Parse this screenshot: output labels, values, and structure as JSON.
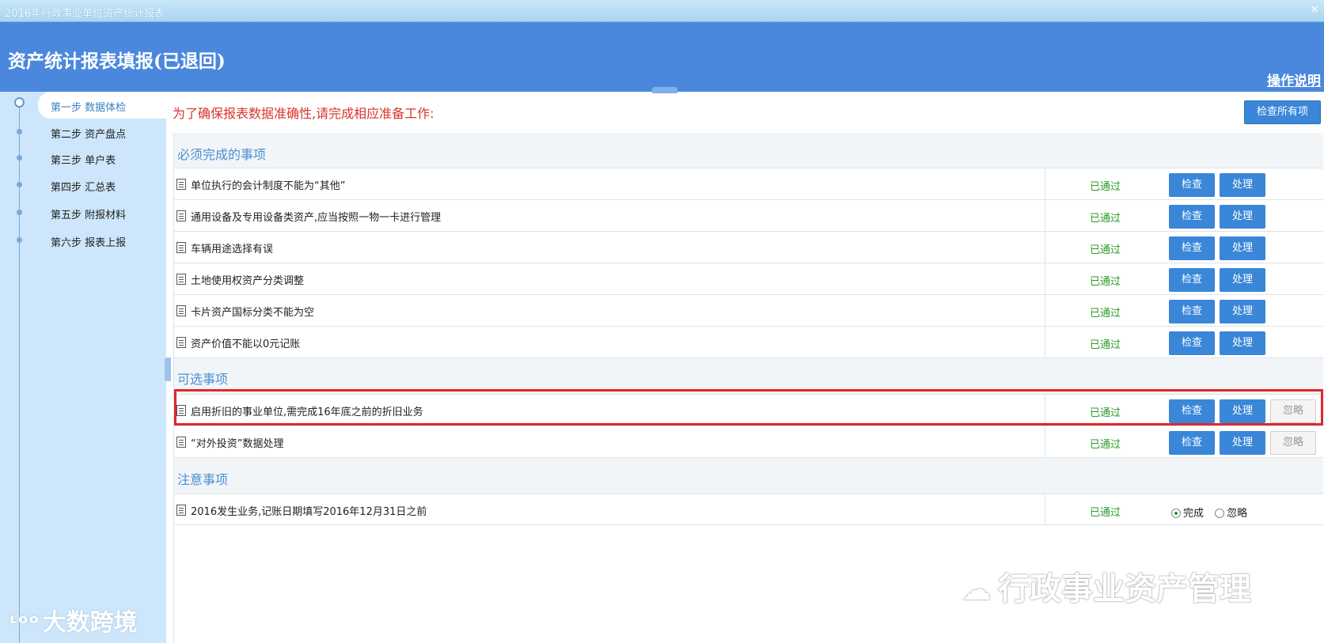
{
  "window": {
    "title": "2016年行政事业单位资产统计报表",
    "close_glyph": "×"
  },
  "header": {
    "title": "资产统计报表填报(已退回)",
    "help_link": "操作说明"
  },
  "sidebar": {
    "steps": [
      {
        "label": "第一步 数据体检",
        "active": true
      },
      {
        "label": "第二步 资产盘点",
        "active": false
      },
      {
        "label": "第三步 单户表",
        "active": false
      },
      {
        "label": "第四步 汇总表",
        "active": false
      },
      {
        "label": "第五步 附报材料",
        "active": false
      },
      {
        "label": "第六步 报表上报",
        "active": false
      }
    ]
  },
  "main": {
    "notice": "为了确保报表数据准确性,请完成相应准备工作:",
    "check_all_label": "检查所有项",
    "check_label": "检查",
    "handle_label": "处理",
    "ignore_label": "忽略",
    "sections": [
      {
        "title": "必须完成的事项",
        "items": [
          {
            "text": "单位执行的会计制度不能为“其他”",
            "status": "已通过"
          },
          {
            "text": "通用设备及专用设备类资产,应当按照一物一卡进行管理",
            "status": "已通过"
          },
          {
            "text": "车辆用途选择有误",
            "status": "已通过"
          },
          {
            "text": "土地使用权资产分类调整",
            "status": "已通过"
          },
          {
            "text": "卡片资产国标分类不能为空",
            "status": "已通过"
          },
          {
            "text": "资产价值不能以0元记账",
            "status": "已通过"
          }
        ]
      },
      {
        "title": "可选事项",
        "items": [
          {
            "text": "启用折旧的事业单位,需完成16年底之前的折旧业务",
            "status": "已通过",
            "highlighted": true
          },
          {
            "text": "“对外投资”数据处理",
            "status": "已通过"
          }
        ]
      },
      {
        "title": "注意事项",
        "items": [
          {
            "text": "2016发生业务,记账日期填写2016年12月31日之前",
            "status": "已通过",
            "radio_options": [
              "完成",
              "忽略"
            ],
            "radio_selected": "完成"
          }
        ]
      }
    ]
  },
  "watermarks": {
    "left": "大数跨境",
    "right": "行政事业资产管理"
  },
  "colors": {
    "header_blue": "#4a88dd",
    "sidebar_bg": "#cde6fb",
    "button_blue": "#3a86d8",
    "status_green": "#2a9a2a",
    "notice_red": "#d9342b",
    "highlight_red": "#e0282a"
  }
}
